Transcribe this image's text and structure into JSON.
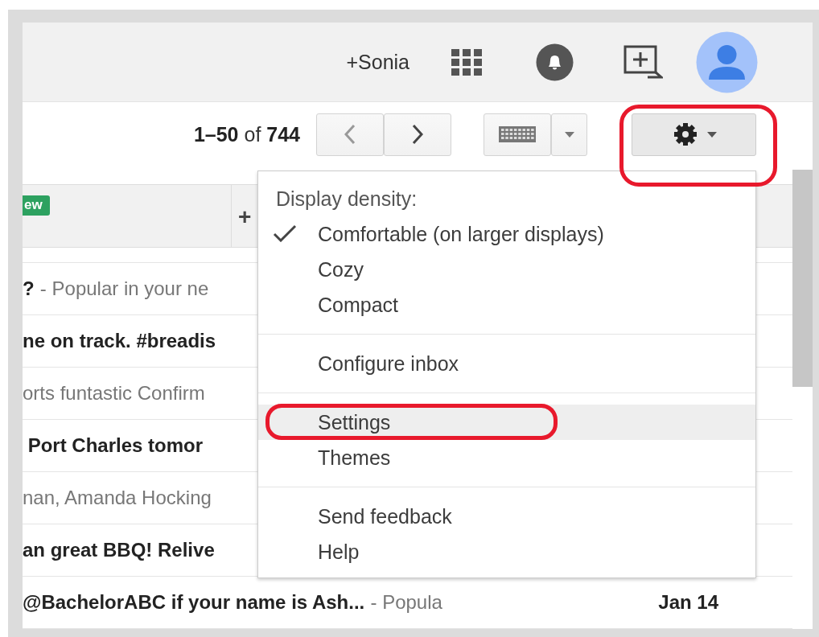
{
  "header": {
    "user_link": "+Sonia"
  },
  "toolbar": {
    "range": "**1–50** of **744**"
  },
  "tabs_bar": {
    "badge": "ew",
    "add_label": "+"
  },
  "rows": [
    {
      "subject": "?",
      "snippet": "- Popular in your ne"
    },
    {
      "subject": "ne on track. #breadis"
    },
    {
      "snippet": "orts funtastic Confirm"
    },
    {
      "subject": " Port Charles tomor"
    },
    {
      "snippet": "nan, Amanda Hocking"
    },
    {
      "subject": "an great BBQ! Relive"
    },
    {
      "subject": "@BachelorABC if your name is Ash...",
      "snippet": "- Popula",
      "date": "Jan 14"
    }
  ],
  "menu": {
    "items": [
      {
        "kind": "header",
        "label": "Display density:"
      },
      {
        "kind": "option",
        "label": "Comfortable (on larger displays)",
        "checked": true
      },
      {
        "kind": "option",
        "label": "Cozy",
        "checked": false
      },
      {
        "kind": "option",
        "label": "Compact",
        "checked": false
      },
      {
        "kind": "divider"
      },
      {
        "kind": "action",
        "label": "Configure inbox",
        "selected": false
      },
      {
        "kind": "divider"
      },
      {
        "kind": "action",
        "label": "Settings",
        "selected": true
      },
      {
        "kind": "action",
        "label": "Themes",
        "selected": false
      },
      {
        "kind": "divider"
      },
      {
        "kind": "action",
        "label": "Send feedback",
        "selected": false
      },
      {
        "kind": "action",
        "label": "Help",
        "selected": false
      }
    ]
  }
}
